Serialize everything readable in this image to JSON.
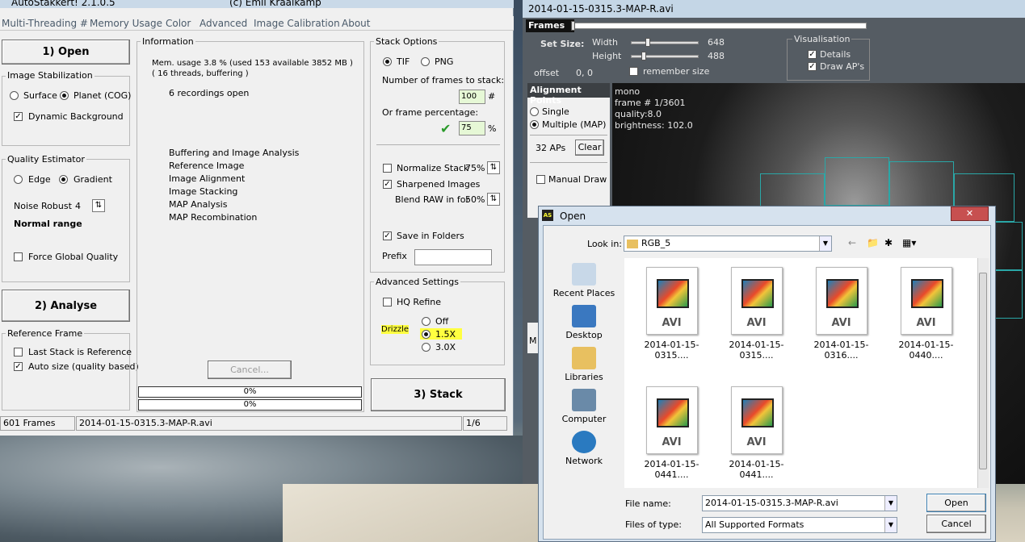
{
  "desktop": {
    "bg": "#4a5a6a"
  },
  "as": {
    "title": "AutoStakkert! 2.1.0.5",
    "author": "(c) Emil Kraaikamp",
    "menu": [
      "Multi-Threading #",
      "Memory Usage",
      "Color",
      "Advanced",
      "Image Calibration",
      "About"
    ],
    "open_btn": "1) Open",
    "analyse_btn": "2) Analyse",
    "stack_btn": "3) Stack",
    "cancel_btn": "Cancel...",
    "image_stab": {
      "title": "Image Stabilization",
      "surface": "Surface",
      "planet": "Planet (COG)",
      "dynamic": "Dynamic Background"
    },
    "quality": {
      "title": "Quality Estimator",
      "edge": "Edge",
      "gradient": "Gradient",
      "noise_label": "Noise Robust",
      "noise_val": "4",
      "range": "Normal range",
      "force": "Force Global Quality"
    },
    "ref": {
      "title": "Reference Frame",
      "last": "Last Stack is Reference",
      "auto": "Auto size (quality based)"
    },
    "info": {
      "title": "Information",
      "mem": "Mem. usage 3.8 %  (used 153 available 3852 MB )",
      "threads": "( 16 threads, buffering )",
      "recordings": "6 recordings open",
      "steps": [
        "Buffering and Image Analysis",
        "Reference Image",
        "Image Alignment",
        "Image Stacking",
        "MAP Analysis",
        "MAP Recombination"
      ]
    },
    "progress": [
      "0%",
      "0%"
    ],
    "stack": {
      "title": "Stack Options",
      "tif": "TIF",
      "png": "PNG",
      "frames_label": "Number of frames to stack:",
      "frames_val": "100",
      "hash": "#",
      "pct_label": "Or frame percentage:",
      "pct_val": "75",
      "pct": "%",
      "normalize": "Normalize Stack",
      "normalize_val": "75%",
      "sharpened": "Sharpened Images",
      "blend": "Blend RAW in for",
      "blend_val": "50%",
      "save": "Save in Folders",
      "prefix": "Prefix"
    },
    "adv": {
      "title": "Advanced Settings",
      "hq": "HQ Refine",
      "drizzle": "Drizzle",
      "off": "Off",
      "x15": "1.5X",
      "x30": "3.0X"
    },
    "status": {
      "frames": "601 Frames",
      "file": "2014-01-15-0315.3-MAP-R.avi",
      "index": "1/6"
    }
  },
  "pv": {
    "title": "2014-01-15-0315.3-MAP-R.avi",
    "frames": "Frames",
    "setsize": "Set Size:",
    "width": "Width",
    "width_val": "648",
    "height": "Height",
    "height_val": "488",
    "remember": "remember size",
    "offset": "offset",
    "offset_val": "0, 0",
    "vis": "Visualisation",
    "details": "Details",
    "draw_aps": "Draw AP's",
    "ap_title": "Alignment Points",
    "single": "Single",
    "multiple": "Multiple (MAP)",
    "aps": "32 APs",
    "clear": "Clear",
    "manual": "Manual Draw",
    "overlay": [
      "mono",
      "frame # 1/3601",
      "quality:8.0",
      "brightness: 102.0"
    ],
    "stub_a": "M"
  },
  "od": {
    "title": "Open",
    "lookin": "Look in:",
    "folder": "RGB_5",
    "places": [
      "Recent Places",
      "Desktop",
      "Libraries",
      "Computer",
      "Network"
    ],
    "files": [
      "2014-01-15-0315....",
      "2014-01-15-0315....",
      "2014-01-15-0316....",
      "2014-01-15-0440....",
      "2014-01-15-0441....",
      "2014-01-15-0441...."
    ],
    "avi": "AVI",
    "filename_label": "File name:",
    "filename": "2014-01-15-0315.3-MAP-R.avi",
    "type_label": "Files of type:",
    "type": "All Supported Formats",
    "open": "Open",
    "cancel": "Cancel",
    "close": "✕"
  }
}
